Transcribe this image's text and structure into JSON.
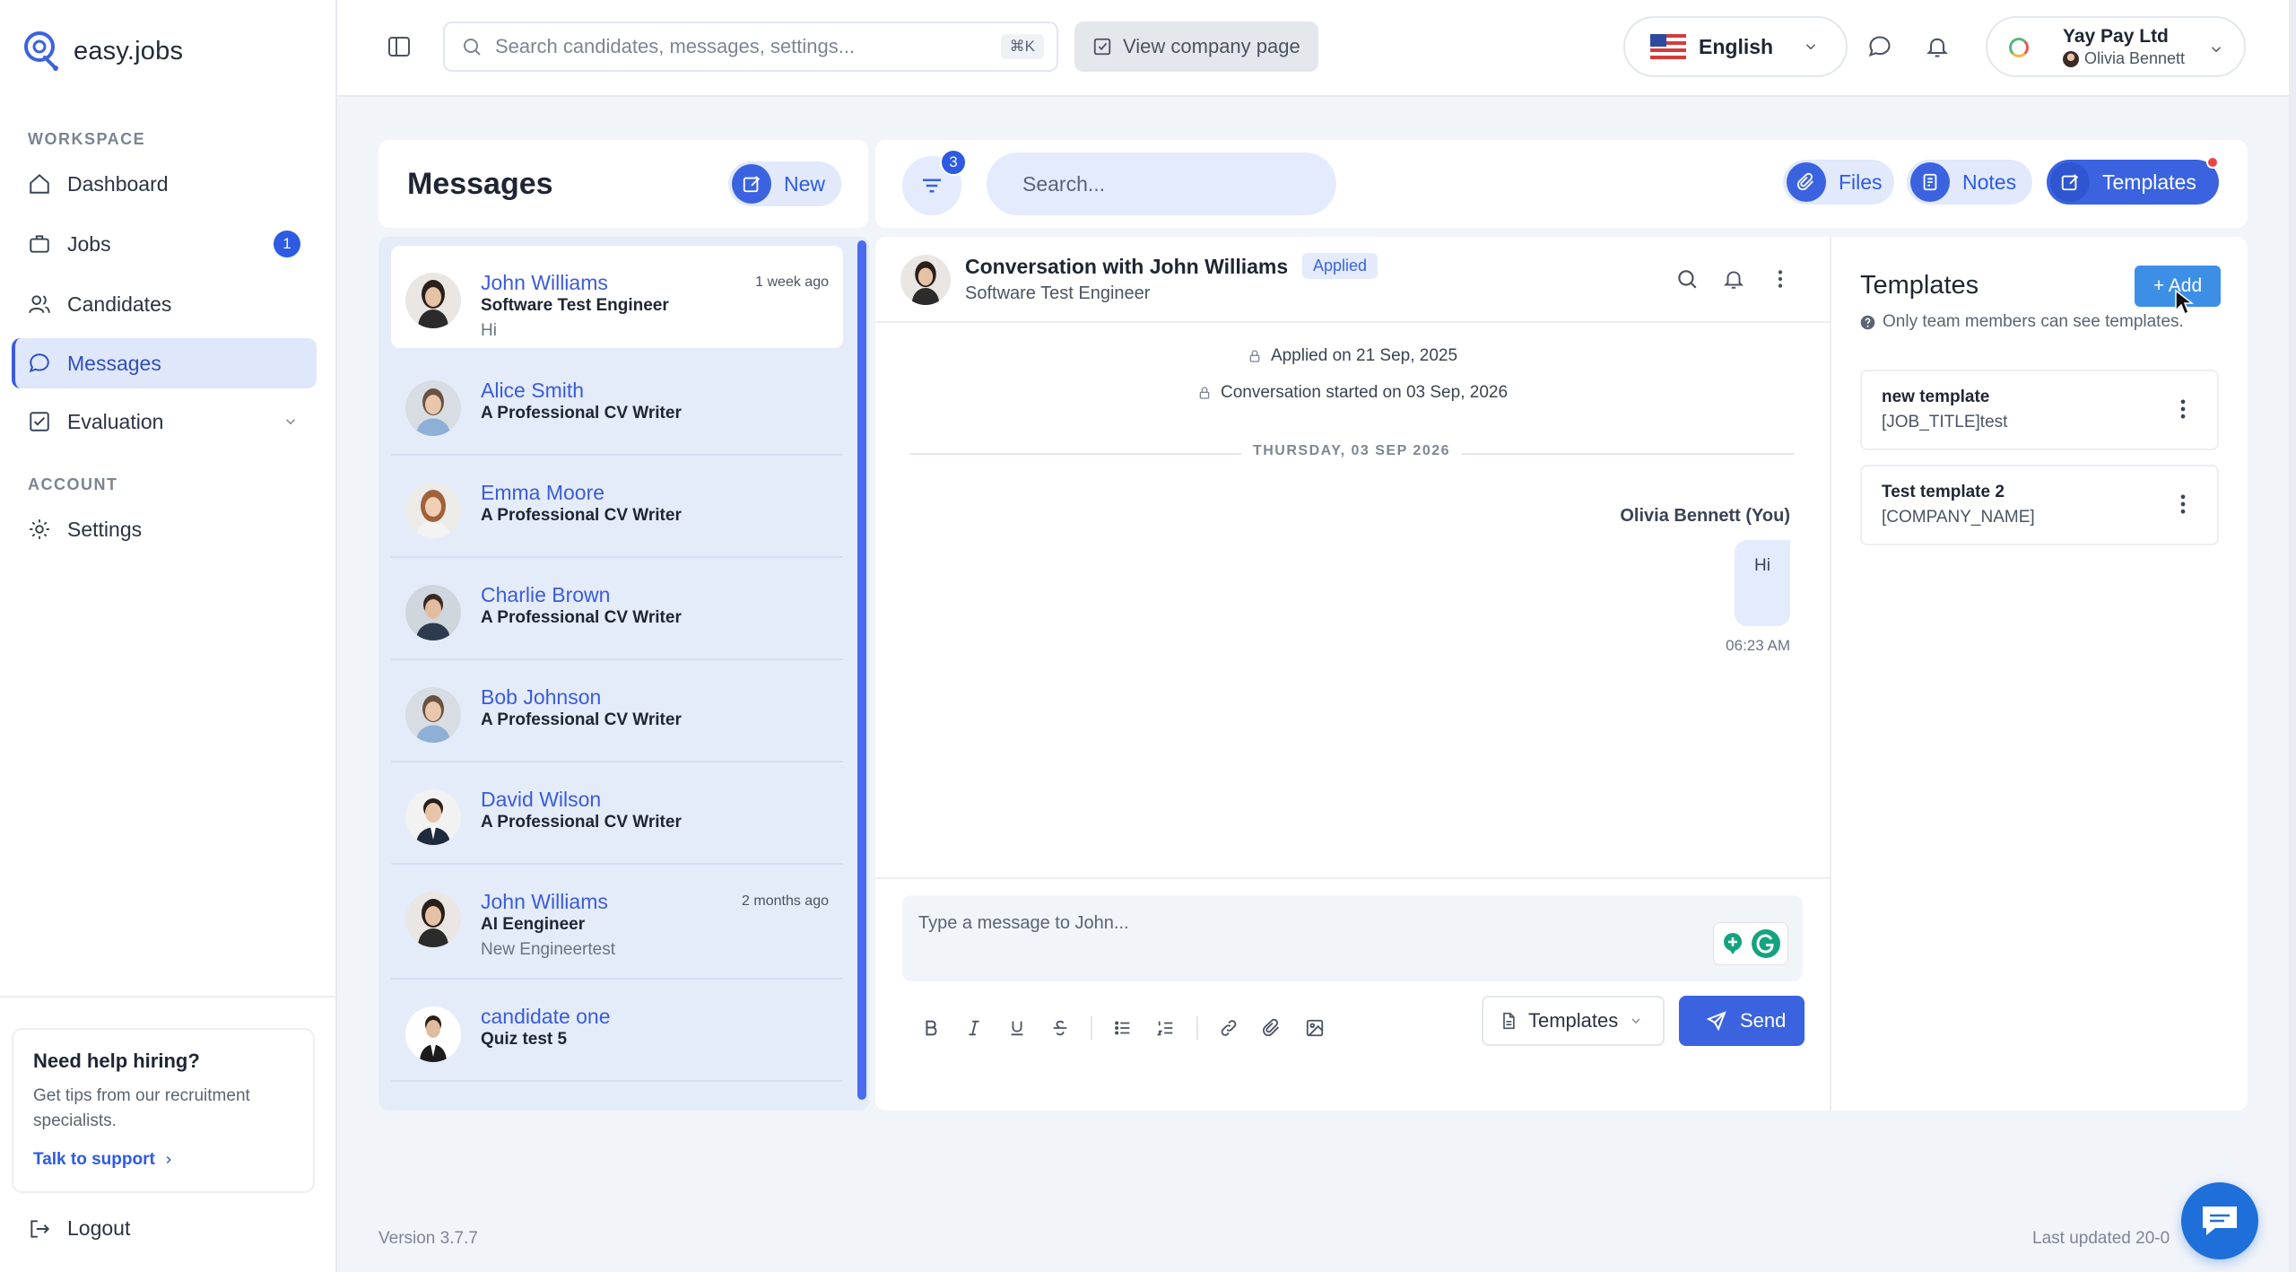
{
  "app": {
    "name": "easy.jobs",
    "version": "Version 3.7.7",
    "last_updated": "Last updated 20-0"
  },
  "sidebar": {
    "workspace_label": "WORKSPACE",
    "account_label": "ACCOUNT",
    "items": [
      {
        "label": "Dashboard",
        "icon": "home-icon"
      },
      {
        "label": "Jobs",
        "icon": "briefcase-icon",
        "badge": "1"
      },
      {
        "label": "Candidates",
        "icon": "users-icon"
      },
      {
        "label": "Messages",
        "icon": "chat-icon",
        "active": true
      },
      {
        "label": "Evaluation",
        "icon": "checklist-icon"
      }
    ],
    "settings_label": "Settings",
    "help": {
      "title": "Need help hiring?",
      "text": "Get tips from our recruitment specialists.",
      "link": "Talk to support"
    },
    "logout_label": "Logout"
  },
  "topbar": {
    "search_placeholder": "Search candidates, messages, settings...",
    "search_shortcut": "⌘K",
    "view_company": "View company page",
    "language": "English",
    "company_name": "Yay Pay Ltd",
    "user_name": "Olivia Bennett"
  },
  "messages_header": {
    "title": "Messages",
    "new_label": "New"
  },
  "toolbar": {
    "filter_count": "3",
    "search_placeholder": "Search...",
    "files_label": "Files",
    "notes_label": "Notes",
    "templates_label": "Templates"
  },
  "conversations": [
    {
      "name": "John Williams",
      "role": "Software Test Engineer",
      "snippet": "Hi",
      "time": "1 week ago",
      "selected": true
    },
    {
      "name": "Alice Smith",
      "role": "A Professional CV Writer",
      "snippet": "",
      "time": ""
    },
    {
      "name": "Emma Moore",
      "role": "A Professional CV Writer",
      "snippet": "",
      "time": ""
    },
    {
      "name": "Charlie Brown",
      "role": "A Professional CV Writer",
      "snippet": "",
      "time": ""
    },
    {
      "name": "Bob Johnson",
      "role": "A Professional CV Writer",
      "snippet": "",
      "time": ""
    },
    {
      "name": "David Wilson",
      "role": "A Professional CV Writer",
      "snippet": "",
      "time": ""
    },
    {
      "name": "John Williams",
      "role": "AI Eengineer",
      "snippet": "New Engineertest",
      "time": "2 months ago"
    },
    {
      "name": "candidate one",
      "role": "Quiz test 5",
      "snippet": "",
      "time": ""
    }
  ],
  "chat": {
    "title": "Conversation with John Williams",
    "status": "Applied",
    "subtitle": "Software Test Engineer",
    "applied_on": "Applied on 21 Sep, 2025",
    "started_on": "Conversation started on 03 Sep, 2026",
    "day_separator": "THURSDAY, 03 SEP 2026",
    "sender": "Olivia Bennett (You)",
    "message": "Hi",
    "message_time": "06:23 AM",
    "composer_placeholder": "Type a message to John...",
    "templates_label": "Templates",
    "send_label": "Send"
  },
  "templates_panel": {
    "title": "Templates",
    "add_label": "+ Add",
    "note": "Only team members can see templates.",
    "items": [
      {
        "name": "new template",
        "body": "[JOB_TITLE]test"
      },
      {
        "name": "Test template 2",
        "body": "[COMPANY_NAME]"
      }
    ]
  },
  "colors": {
    "accent": "#3b63e0",
    "sidebar_active_bg": "#dfe7fb",
    "list_bg": "#e4ecfa",
    "add_button": "#3d8fe6"
  }
}
